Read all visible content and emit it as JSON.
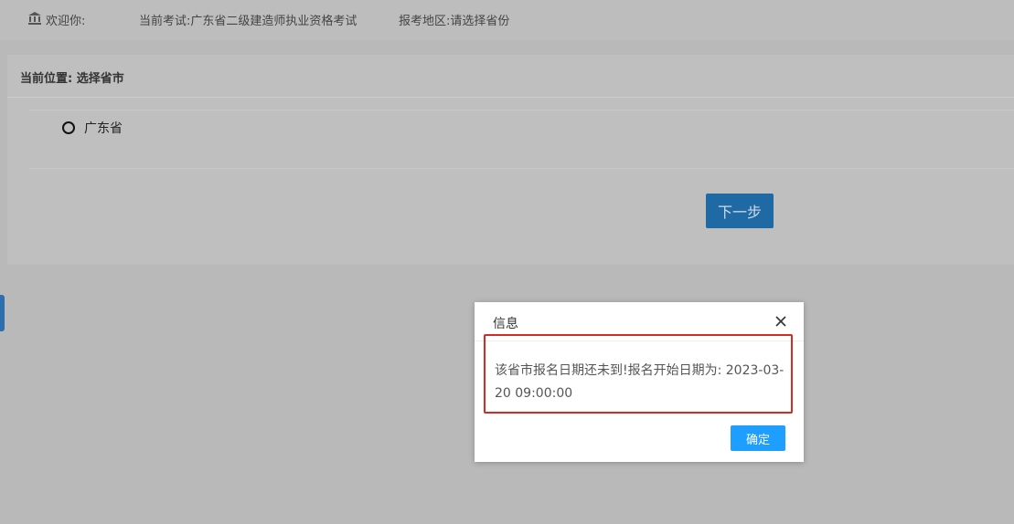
{
  "topbar": {
    "welcome": "欢迎你:",
    "exam_label": "当前考试:",
    "exam_name": "广东省二级建造师执业资格考试",
    "region_label": "报考地区:",
    "region_value": "请选择省份",
    "icon": "bank-icon"
  },
  "main": {
    "breadcrumb": "当前位置: 选择省市",
    "provinces": [
      {
        "label": "广东省",
        "selected": false
      }
    ],
    "next_button": "下一步"
  },
  "dialog": {
    "title": "信息",
    "message": "该省市报名日期还未到!报名开始日期为: 2023-03-20 09:00:00",
    "ok_button": "确定",
    "close_icon": "close-icon",
    "highlight_color": "#d42b24"
  },
  "colors": {
    "primary_button": "#1f6aa5",
    "dialog_button": "#1e9fff",
    "overlay": "#b9b9b9"
  }
}
